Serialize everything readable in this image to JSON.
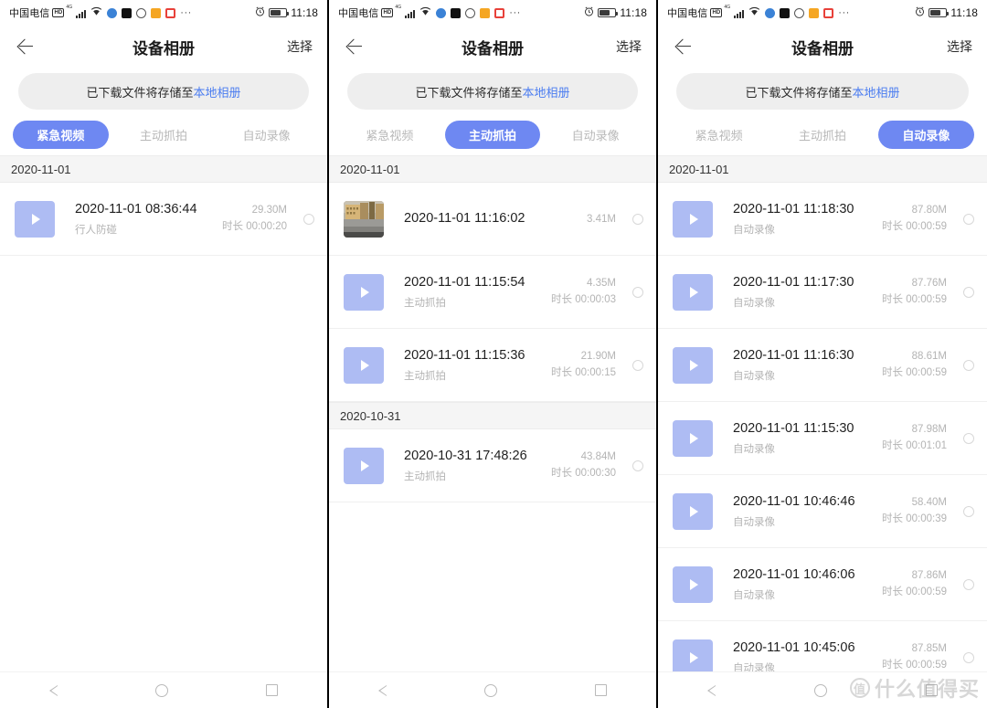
{
  "status_bar": {
    "carrier": "中国电信",
    "hd_badge": "HD",
    "signal_label": "4G",
    "ellipsis": "···",
    "time": "11:18",
    "app_icon_colors": [
      "#3b82d6",
      "#111111",
      "#555555",
      "#f5a623",
      "#e8413a"
    ]
  },
  "app_bar": {
    "title": "设备相册",
    "action_label": "选择",
    "back_icon": "back-arrow-icon"
  },
  "banner": {
    "text": "已下载文件将存储至",
    "link_text": "本地相册"
  },
  "colors": {
    "accent": "#6e88f2",
    "thumb": "#aebcf3",
    "link": "#4a7cf0",
    "muted_text": "#b4b4b4"
  },
  "nav_bar": {
    "back": "nav-back-icon",
    "home": "nav-home-icon",
    "recents": "nav-recents-icon"
  },
  "watermark": {
    "badge": "值",
    "text": "什么值得买"
  },
  "tabs": [
    {
      "label": "紧急视频"
    },
    {
      "label": "主动抓拍"
    },
    {
      "label": "自动录像"
    }
  ],
  "panels": [
    {
      "active_tab_index": 0,
      "groups": [
        {
          "date": "2020-11-01",
          "items": [
            {
              "title": "2020-11-01 08:36:44",
              "subtitle": "行人防碰",
              "size": "29.30M",
              "duration": "时长 00:00:20",
              "thumb_type": "video"
            }
          ]
        }
      ]
    },
    {
      "active_tab_index": 1,
      "groups": [
        {
          "date": "2020-11-01",
          "items": [
            {
              "title": "2020-11-01 11:16:02",
              "subtitle": "",
              "size": "3.41M",
              "duration": "",
              "thumb_type": "photo"
            },
            {
              "title": "2020-11-01 11:15:54",
              "subtitle": "主动抓拍",
              "size": "4.35M",
              "duration": "时长 00:00:03",
              "thumb_type": "video"
            },
            {
              "title": "2020-11-01 11:15:36",
              "subtitle": "主动抓拍",
              "size": "21.90M",
              "duration": "时长 00:00:15",
              "thumb_type": "video"
            }
          ]
        },
        {
          "date": "2020-10-31",
          "items": [
            {
              "title": "2020-10-31 17:48:26",
              "subtitle": "主动抓拍",
              "size": "43.84M",
              "duration": "时长 00:00:30",
              "thumb_type": "video"
            }
          ]
        }
      ]
    },
    {
      "active_tab_index": 2,
      "groups": [
        {
          "date": "2020-11-01",
          "items": [
            {
              "title": "2020-11-01 11:18:30",
              "subtitle": "自动录像",
              "size": "87.80M",
              "duration": "时长 00:00:59",
              "thumb_type": "video"
            },
            {
              "title": "2020-11-01 11:17:30",
              "subtitle": "自动录像",
              "size": "87.76M",
              "duration": "时长 00:00:59",
              "thumb_type": "video"
            },
            {
              "title": "2020-11-01 11:16:30",
              "subtitle": "自动录像",
              "size": "88.61M",
              "duration": "时长 00:00:59",
              "thumb_type": "video"
            },
            {
              "title": "2020-11-01 11:15:30",
              "subtitle": "自动录像",
              "size": "87.98M",
              "duration": "时长 00:01:01",
              "thumb_type": "video"
            },
            {
              "title": "2020-11-01 10:46:46",
              "subtitle": "自动录像",
              "size": "58.40M",
              "duration": "时长 00:00:39",
              "thumb_type": "video"
            },
            {
              "title": "2020-11-01 10:46:06",
              "subtitle": "自动录像",
              "size": "87.86M",
              "duration": "时长 00:00:59",
              "thumb_type": "video"
            },
            {
              "title": "2020-11-01 10:45:06",
              "subtitle": "自动录像",
              "size": "87.85M",
              "duration": "时长 00:00:59",
              "thumb_type": "video"
            }
          ]
        }
      ]
    }
  ]
}
